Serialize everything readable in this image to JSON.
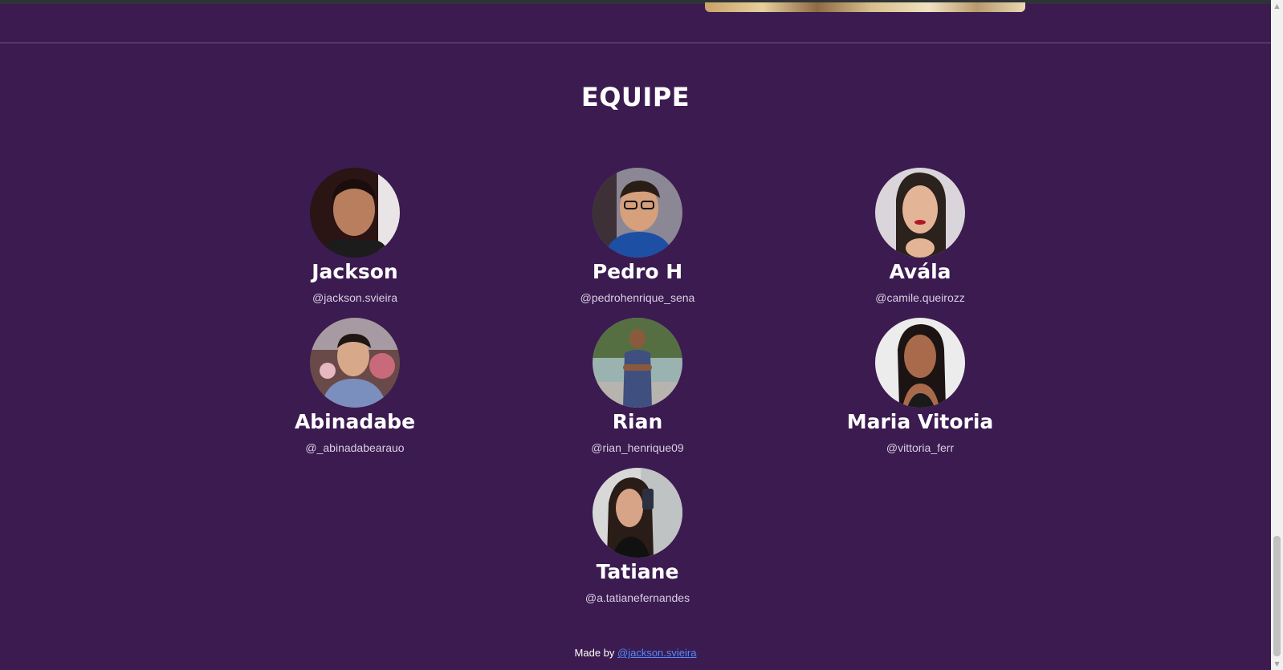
{
  "section": {
    "title": "EQUIPE"
  },
  "members": [
    {
      "name": "Jackson",
      "handle": "@jackson.svieira"
    },
    {
      "name": "Pedro H",
      "handle": "@pedrohenrique_sena"
    },
    {
      "name": "Avála",
      "handle": "@camile.queirozz"
    },
    {
      "name": "Abinadabe",
      "handle": "@_abinadabearauo"
    },
    {
      "name": "Rian",
      "handle": "@rian_henrique09"
    },
    {
      "name": "Maria Vitoria",
      "handle": "@vittoria_ferr"
    },
    {
      "name": "Tatiane",
      "handle": "@a.tatianefernandes"
    }
  ],
  "footer": {
    "prefix": "Made by ",
    "link_text": "@jackson.svieira"
  },
  "colors": {
    "background": "#3b1b50",
    "text": "#ffffff",
    "handle": "#d9cfe3",
    "link": "#4f8cff"
  }
}
